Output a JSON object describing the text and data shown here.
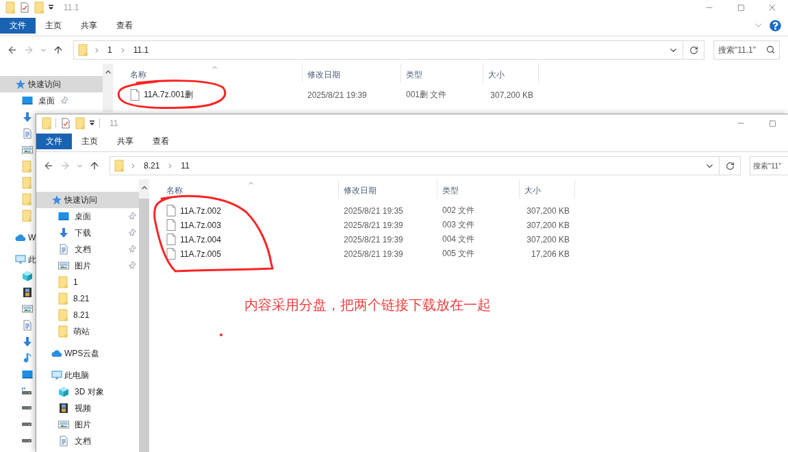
{
  "back_window": {
    "title": "11.1",
    "ribbon_tabs": [
      {
        "label": "文件",
        "kind": "file-menu"
      },
      {
        "label": "主页",
        "kind": "tab"
      },
      {
        "label": "共享",
        "kind": "tab"
      },
      {
        "label": "查看",
        "kind": "tab"
      }
    ],
    "breadcrumb": [
      "1",
      "11.1"
    ],
    "search": {
      "placeholder": "搜索\"11.1\""
    },
    "sidebar": [
      {
        "label": "快速访问",
        "kind": "quick-access",
        "selected": true,
        "children": [
          {
            "label": "桌面",
            "kind": "desktop",
            "pinned": true
          },
          {
            "kind": "downloads"
          },
          {
            "kind": "documents"
          },
          {
            "kind": "pictures"
          },
          {
            "kind": "folder"
          },
          {
            "kind": "folder"
          },
          {
            "kind": "folder"
          },
          {
            "kind": "folder"
          }
        ]
      },
      {
        "label": "W",
        "kind": "cloud",
        "selected": false
      },
      {
        "label": "此",
        "kind": "computer",
        "selected": false,
        "children": [
          {
            "kind": "objects-3d"
          },
          {
            "kind": "videos"
          },
          {
            "kind": "pictures"
          },
          {
            "kind": "documents"
          },
          {
            "kind": "downloads"
          },
          {
            "kind": "music"
          },
          {
            "kind": "desktop"
          },
          {
            "kind": "system-drive"
          },
          {
            "kind": "drive"
          },
          {
            "kind": "drive"
          },
          {
            "kind": "drive"
          }
        ]
      }
    ],
    "columns": [
      {
        "label": "名称",
        "sorted": true
      },
      {
        "label": "修改日期",
        "sorted": false
      },
      {
        "label": "类型",
        "sorted": false
      },
      {
        "label": "大小",
        "sorted": false
      }
    ],
    "files": [
      {
        "name": "11A.7z.001删",
        "modified": "2025/8/21 19:39",
        "type": "001删 文件",
        "size": "307,200 KB"
      }
    ]
  },
  "front_window": {
    "title": "11",
    "ribbon_tabs": [
      {
        "label": "文件",
        "kind": "file-menu"
      },
      {
        "label": "主页",
        "kind": "tab"
      },
      {
        "label": "共享",
        "kind": "tab"
      },
      {
        "label": "查看",
        "kind": "tab"
      }
    ],
    "breadcrumb": [
      "8.21",
      "11"
    ],
    "search": {
      "placeholder": "搜索\"11\""
    },
    "sidebar": [
      {
        "label": "快速访问",
        "kind": "quick-access",
        "selected": true,
        "children": [
          {
            "label": "桌面",
            "kind": "desktop",
            "pinned": true
          },
          {
            "label": "下载",
            "kind": "downloads",
            "pinned": true
          },
          {
            "label": "文档",
            "kind": "documents",
            "pinned": true
          },
          {
            "label": "图片",
            "kind": "pictures",
            "pinned": true
          },
          {
            "label": "1",
            "kind": "folder",
            "pinned": false
          },
          {
            "label": "8.21",
            "kind": "folder",
            "pinned": false
          },
          {
            "label": "8.21",
            "kind": "folder",
            "pinned": false
          },
          {
            "label": "萌站",
            "kind": "folder",
            "pinned": false
          }
        ]
      },
      {
        "label": "WPS云盘",
        "kind": "cloud",
        "selected": false
      },
      {
        "label": "此电脑",
        "kind": "computer",
        "selected": false,
        "children": [
          {
            "label": "3D 对象",
            "kind": "objects-3d",
            "pinned": false
          },
          {
            "label": "视频",
            "kind": "videos",
            "pinned": false
          },
          {
            "label": "图片",
            "kind": "pictures",
            "pinned": false
          },
          {
            "label": "文档",
            "kind": "documents",
            "pinned": false
          }
        ]
      }
    ],
    "columns": [
      {
        "label": "名称",
        "sorted": true
      },
      {
        "label": "修改日期",
        "sorted": false
      },
      {
        "label": "类型",
        "sorted": false
      },
      {
        "label": "大小",
        "sorted": false
      }
    ],
    "files": [
      {
        "name": "11A.7z.002",
        "modified": "2025/8/21 19:35",
        "type": "002 文件",
        "size": "307,200 KB"
      },
      {
        "name": "11A.7z.003",
        "modified": "2025/8/21 19:39",
        "type": "003 文件",
        "size": "307,200 KB"
      },
      {
        "name": "11A.7z.004",
        "modified": "2025/8/21 19:39",
        "type": "004 文件",
        "size": "307,200 KB"
      },
      {
        "name": "11A.7z.005",
        "modified": "2025/8/21 19:39",
        "type": "005 文件",
        "size": "17,206 KB"
      }
    ]
  },
  "annotation": {
    "note": "内容采用分盘，把两个链接下载放在一起"
  }
}
